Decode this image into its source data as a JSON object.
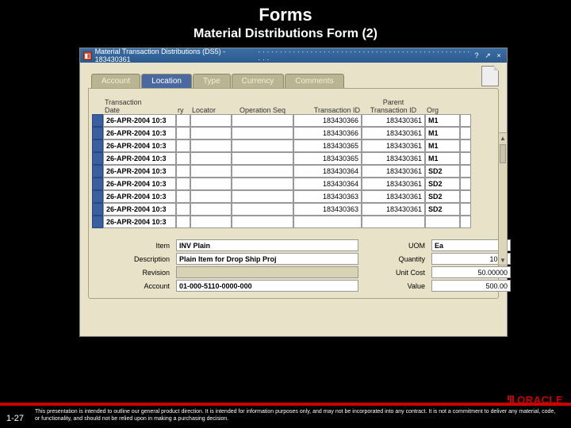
{
  "slide": {
    "title1": "Forms",
    "title2": "Material Distributions Form (2)",
    "pagenum": "1-27",
    "disclaimer": "This presentation is intended to outline our general product direction. It is intended for information purposes only, and may not be incorporated into any contract. It is not a commitment to deliver any material, code, or functionality, and should not be relied upon in making a purchasing decision.",
    "logo": "ORACLE"
  },
  "window": {
    "title": "Material Transaction Distributions (DS5) - 183430361"
  },
  "tabs": [
    "Account",
    "Location",
    "Type",
    "Currency",
    "Comments"
  ],
  "active_tab": "Location",
  "headers": {
    "date": "Transaction\nDate",
    "ry": "ry",
    "locator": "Locator",
    "opseq": "Operation Seq",
    "txid": "Transaction ID",
    "ptxid": "Parent\nTransaction ID",
    "org": "Org"
  },
  "rows": [
    {
      "date": "26-APR-2004 10:3",
      "txid": "183430366",
      "ptxid": "183430361",
      "org": "M1"
    },
    {
      "date": "26-APR-2004 10:3",
      "txid": "183430366",
      "ptxid": "183430361",
      "org": "M1"
    },
    {
      "date": "26-APR-2004 10:3",
      "txid": "183430365",
      "ptxid": "183430361",
      "org": "M1"
    },
    {
      "date": "26-APR-2004 10:3",
      "txid": "183430365",
      "ptxid": "183430361",
      "org": "M1"
    },
    {
      "date": "26-APR-2004 10:3",
      "txid": "183430364",
      "ptxid": "183430361",
      "org": "SD2"
    },
    {
      "date": "26-APR-2004 10:3",
      "txid": "183430364",
      "ptxid": "183430361",
      "org": "SD2"
    },
    {
      "date": "26-APR-2004 10:3",
      "txid": "183430363",
      "ptxid": "183430361",
      "org": "SD2"
    },
    {
      "date": "26-APR-2004 10:3",
      "txid": "183430363",
      "ptxid": "183430361",
      "org": "SD2"
    },
    {
      "date": "26-APR-2004 10:3",
      "txid": "",
      "ptxid": "",
      "org": "",
      "hatched": true
    }
  ],
  "detail": {
    "item_label": "Item",
    "item": "INV Plain",
    "desc_label": "Description",
    "desc": "Plain Item for Drop Ship Proj",
    "rev_label": "Revision",
    "rev": "",
    "acct_label": "Account",
    "acct": "01-000-5110-0000-000",
    "uom_label": "UOM",
    "uom": "Ea",
    "qty_label": "Quantity",
    "qty": "10.00",
    "ucost_label": "Unit Cost",
    "ucost": "50.00000",
    "value_label": "Value",
    "value": "500.00"
  }
}
